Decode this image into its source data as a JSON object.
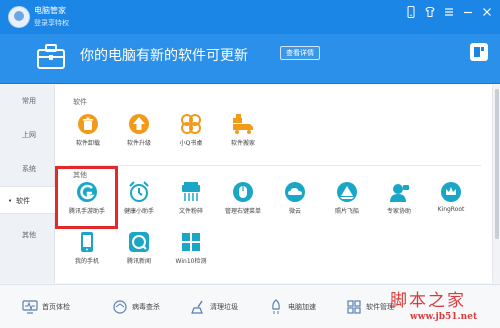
{
  "titlebar": {
    "app_name": "电脑管家",
    "login_text": "登录享特权"
  },
  "banner": {
    "title": "你的电脑有新的软件可更新",
    "button_label": "查看详情"
  },
  "sidebar": {
    "items": [
      {
        "label": "常用"
      },
      {
        "label": "上网"
      },
      {
        "label": "系统"
      },
      {
        "label": "软件"
      },
      {
        "label": "其他"
      }
    ],
    "active": "软件"
  },
  "software_section": {
    "title": "软件",
    "apps": [
      {
        "label": "软件卸载",
        "icon": "trash-icon"
      },
      {
        "label": "软件升级",
        "icon": "upgrade-arrow-icon"
      },
      {
        "label": "小Q书桌",
        "icon": "clover-icon"
      },
      {
        "label": "软件搬家",
        "icon": "moving-truck-icon"
      }
    ]
  },
  "other_section": {
    "title": "其他",
    "apps": [
      {
        "label": "腾讯手游助手",
        "icon": "game-assistant-icon"
      },
      {
        "label": "健康小助手",
        "icon": "alarm-clock-icon"
      },
      {
        "label": "文件粉碎",
        "icon": "file-shredder-icon"
      },
      {
        "label": "管理右键菜单",
        "icon": "mouse-icon"
      },
      {
        "label": "微云",
        "icon": "weiyun-cloud-icon"
      },
      {
        "label": "照片飞船",
        "icon": "photo-ship-icon"
      },
      {
        "label": "专家协助",
        "icon": "expert-assist-icon"
      },
      {
        "label": "KingRoot",
        "icon": "kingroot-icon"
      },
      {
        "label": "我的手机",
        "icon": "my-phone-icon"
      },
      {
        "label": "腾讯新闻",
        "icon": "tencent-news-icon"
      },
      {
        "label": "Win10检测",
        "icon": "windows-icon"
      }
    ]
  },
  "bottombar": {
    "items": [
      {
        "label": "首页体检",
        "icon": "monitor-icon"
      },
      {
        "label": "病毒查杀",
        "icon": "virus-scan-icon"
      },
      {
        "label": "清理垃圾",
        "icon": "broom-icon"
      },
      {
        "label": "电脑加速",
        "icon": "rocket-icon"
      },
      {
        "label": "软件管理",
        "icon": "software-manager-icon"
      }
    ]
  },
  "watermark": {
    "text": "脚本之家",
    "url": "www.jb51.net"
  },
  "colors": {
    "primary_blue": "#1c86e6",
    "accent_orange": "#f29b1b",
    "app_teal": "#1aa6c6",
    "highlight_red": "#e22a2a"
  }
}
